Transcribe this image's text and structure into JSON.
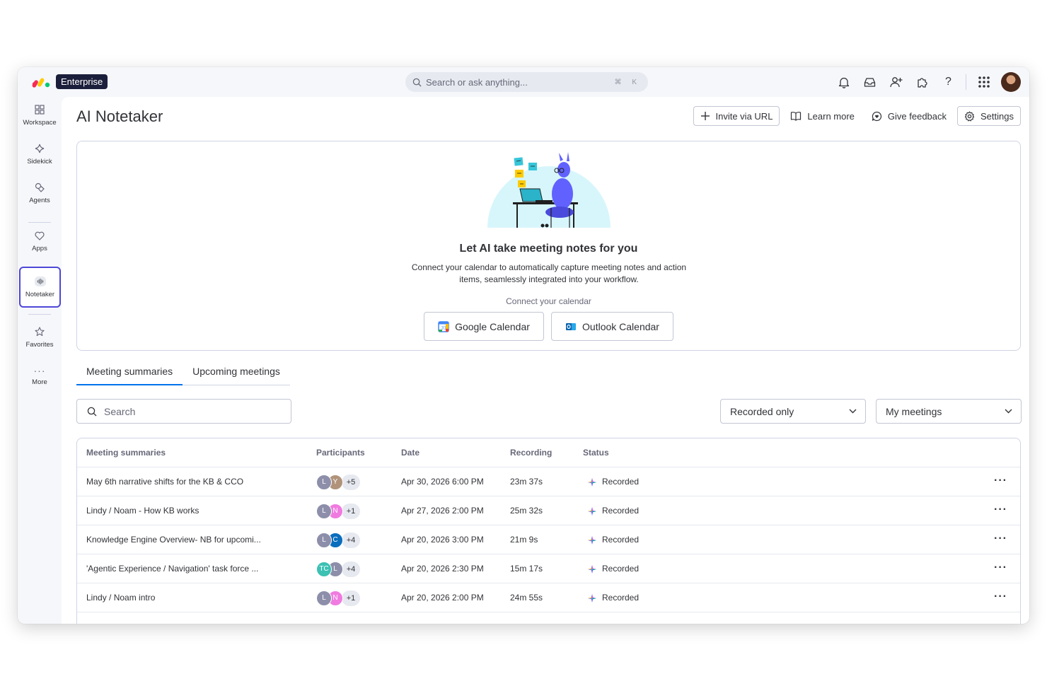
{
  "topbar": {
    "plan_badge": "Enterprise",
    "search_placeholder": "Search or ask anything...",
    "search_shortcut": "⌘ K",
    "icons": [
      "bell-icon",
      "inbox-icon",
      "invite-member-icon",
      "apps-marketplace-icon",
      "help-icon",
      "app-grid-icon"
    ]
  },
  "sidebar": {
    "items": [
      {
        "label": "Workspace",
        "icon": "workspace-grid-icon"
      },
      {
        "label": "Sidekick",
        "icon": "sparkle-icon"
      },
      {
        "label": "Agents",
        "icon": "agents-icon"
      },
      {
        "label": "Apps",
        "icon": "apps-heart-icon"
      },
      {
        "label": "Notetaker",
        "icon": "waveform-icon",
        "active": true
      },
      {
        "label": "Favorites",
        "icon": "star-icon"
      },
      {
        "label": "More",
        "icon": "more-dots-icon"
      }
    ]
  },
  "page": {
    "title": "AI Notetaker",
    "actions": {
      "invite": "Invite via URL",
      "learn": "Learn more",
      "feedback": "Give feedback",
      "settings": "Settings"
    }
  },
  "empty_state": {
    "heading": "Let AI take meeting notes for you",
    "description": "Connect your calendar to automatically capture meeting notes and action items, seamlessly integrated into your workflow.",
    "connect_label": "Connect your calendar",
    "google_button": "Google Calendar",
    "outlook_button": "Outlook Calendar"
  },
  "tabs": [
    {
      "label": "Meeting summaries",
      "active": true
    },
    {
      "label": "Upcoming meetings",
      "active": false
    }
  ],
  "filters": {
    "search_placeholder": "Search",
    "recorded_filter": "Recorded only",
    "meetings_filter": "My meetings"
  },
  "table": {
    "columns": [
      "Meeting summaries",
      "Participants",
      "Date",
      "Recording",
      "Status"
    ],
    "rows": [
      {
        "title": "May 6th narrative shifts for the KB & CCO",
        "participants": [
          {
            "initials": "L",
            "color": "#8d8faa"
          },
          {
            "initials": "Y",
            "color": "#b0937a"
          }
        ],
        "more": "+5",
        "date": "Apr 30, 2026 6:00 PM",
        "recording": "23m 37s",
        "status": "Recorded"
      },
      {
        "title": "Lindy / Noam - How KB works",
        "participants": [
          {
            "initials": "L",
            "color": "#8d8faa"
          },
          {
            "initials": "N",
            "color": "#f07be0"
          }
        ],
        "more": "+1",
        "date": "Apr 27, 2026 2:00 PM",
        "recording": "25m 32s",
        "status": "Recorded"
      },
      {
        "title": "Knowledge Engine Overview- NB for upcomi...",
        "participants": [
          {
            "initials": "L",
            "color": "#8d8faa"
          },
          {
            "initials": "C",
            "color": "#0a6ebd"
          }
        ],
        "more": "+4",
        "date": "Apr 20, 2026 3:00 PM",
        "recording": "21m 9s",
        "status": "Recorded"
      },
      {
        "title": "'Agentic Experience / Navigation' task force ...",
        "participants": [
          {
            "initials": "TC",
            "color": "#3cc1b3"
          },
          {
            "initials": "L",
            "color": "#8d8faa"
          }
        ],
        "more": "+4",
        "date": "Apr 20, 2026 2:30 PM",
        "recording": "15m 17s",
        "status": "Recorded"
      },
      {
        "title": "Lindy / Noam intro",
        "participants": [
          {
            "initials": "L",
            "color": "#8d8faa"
          },
          {
            "initials": "N",
            "color": "#f07be0"
          }
        ],
        "more": "+1",
        "date": "Apr 20, 2026 2:00 PM",
        "recording": "24m 55s",
        "status": "Recorded"
      }
    ]
  },
  "colors": {
    "accent": "#0073ea",
    "active_outline": "#4e47d8",
    "badge_bg": "#1c1f3b"
  }
}
